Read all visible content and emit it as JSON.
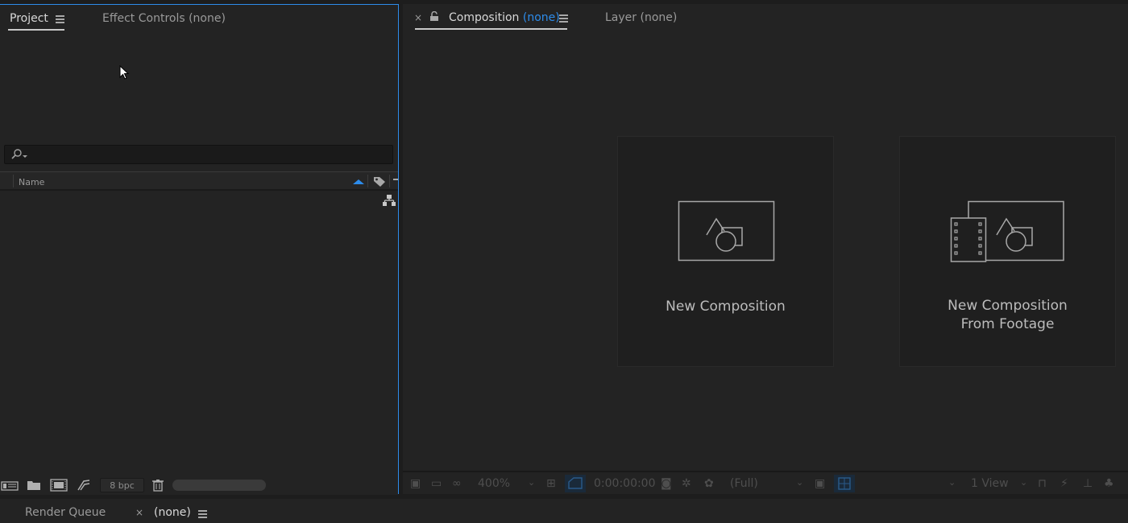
{
  "project_panel": {
    "tabs": {
      "project": "Project",
      "effect_controls": "Effect Controls (none)"
    },
    "search": {
      "placeholder": ""
    },
    "columns": {
      "name": "Name"
    },
    "footer": {
      "bpc": "8 bpc"
    }
  },
  "composition_panel": {
    "tabs": {
      "composition": "Composition",
      "composition_value": "(none)",
      "layer": "Layer  (none)"
    },
    "cards": [
      {
        "label": "New Composition"
      },
      {
        "label_line1": "New Composition",
        "label_line2": "From Footage"
      }
    ],
    "toolbar": {
      "zoom": "400%",
      "timecode": "0:00:00:00",
      "resolution": "(Full)",
      "views": "1 View"
    }
  },
  "bottom_panel": {
    "render_queue": "Render Queue",
    "close_glyph": "×",
    "none_tab": "(none)"
  },
  "colors": {
    "accent": "#2d8ceb",
    "panel": "#232323",
    "background": "#1d1d1d"
  },
  "icons": [
    "menu-icon",
    "search-icon",
    "lock-icon",
    "close-icon",
    "sort-icon",
    "label-icon",
    "flowchart-icon",
    "new-composition-icon",
    "new-composition-from-footage-icon",
    "trash-icon",
    "folder-icon",
    "camera-icon",
    "mouse-cursor-icon"
  ]
}
